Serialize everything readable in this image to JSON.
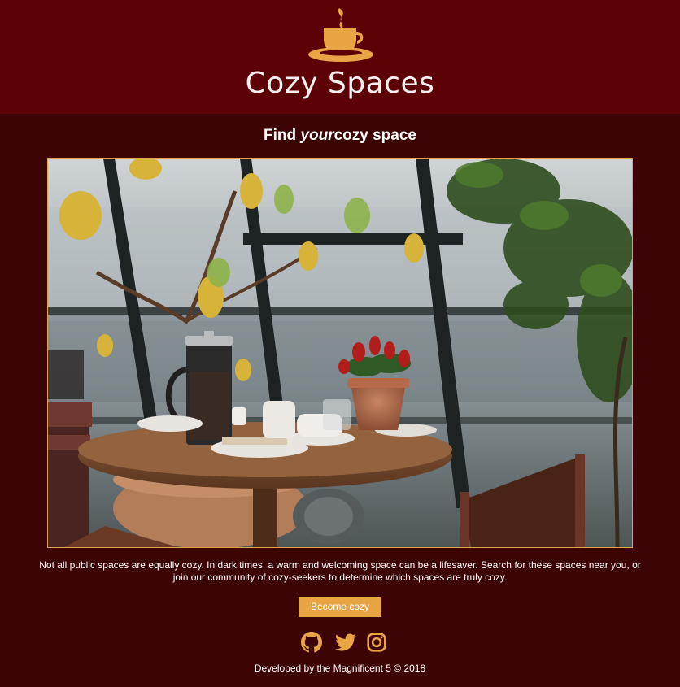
{
  "header": {
    "brand": "Cozy Spaces",
    "logo_icon": "coffee-cup-icon"
  },
  "hero": {
    "tagline_before": "Find ",
    "tagline_emphasis": "your",
    "tagline_after": "cozy space",
    "image_icon": "cafe-table-photo"
  },
  "description": "Not all public spaces are equally cozy. In dark times, a warm and welcoming space can be a lifesaver. Search for these spaces near you, or join our community of cozy-seekers to determine which spaces are truly cozy.",
  "cta": {
    "label": "Become cozy"
  },
  "socials": [
    {
      "icon": "github-icon"
    },
    {
      "icon": "twitter-icon"
    },
    {
      "icon": "instagram-icon"
    }
  ],
  "footer": {
    "credit": "Developed by the Magnificent 5 © 2018"
  },
  "colors": {
    "header_bg": "#5c0207",
    "page_bg": "#3d0406",
    "accent": "#e9a444",
    "text": "#ffffff"
  }
}
